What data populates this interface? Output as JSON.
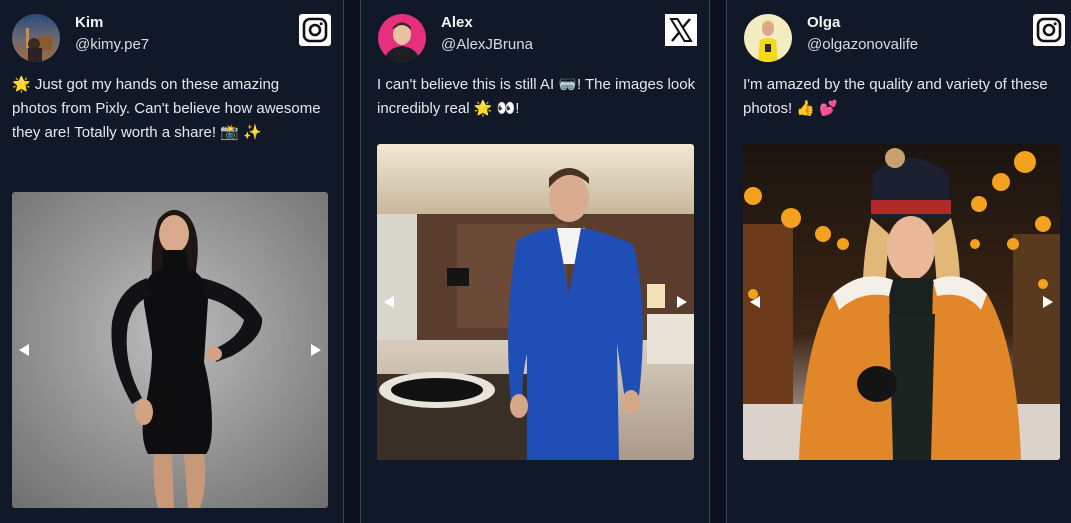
{
  "posts": [
    {
      "name": "Kim",
      "handle": "@kimy.pe7",
      "platform": "instagram",
      "text": "🌟 Just got my hands on these amazing photos from Pixly. Can't believe how awesome they are! Totally worth a share! 📸 ✨",
      "photo_alt": "Woman in black turtleneck dress, studio portrait"
    },
    {
      "name": "Alex",
      "handle": "@AlexJBruna",
      "platform": "x",
      "text": "I can't believe this is still AI 🥽! The images look incredibly real 🌟 👀!",
      "photo_alt": "Man in blue suit in modern living room"
    },
    {
      "name": "Olga",
      "handle": "@olgazonovalife",
      "platform": "instagram",
      "text": "I'm amazed by the quality and variety of these photos! 👍 💕",
      "photo_alt": "Woman in orange winter jacket and knit hat on a lit street"
    }
  ],
  "icons": {
    "prev": "triangle-left-icon",
    "next": "triangle-right-icon"
  },
  "colors": {
    "background": "#0c1120",
    "card": "#111827",
    "card_border": "#3a4358",
    "text": "#e6e8ee"
  }
}
